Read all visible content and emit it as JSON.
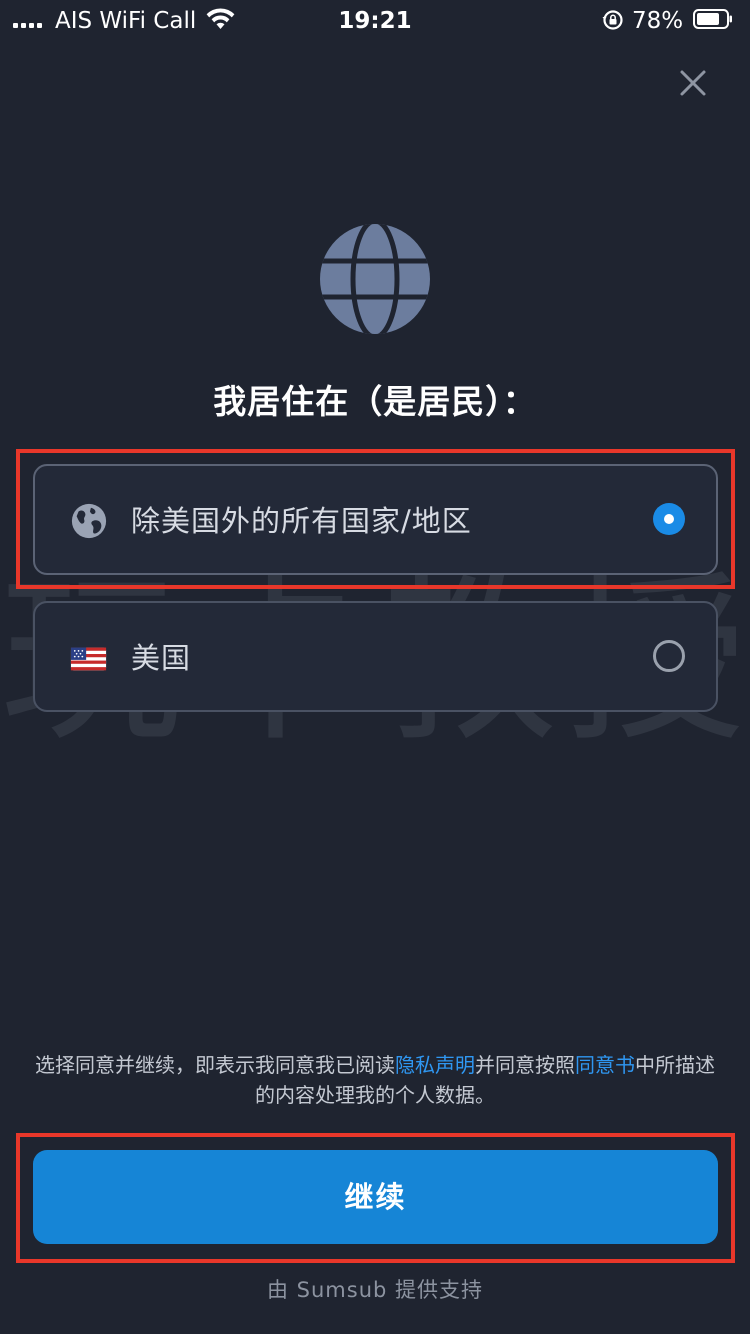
{
  "status_bar": {
    "carrier": "AIS WiFi Call",
    "time": "19:21",
    "battery_percent": "78%"
  },
  "icons": {
    "close": "close-icon",
    "hero": "globe-icon",
    "world_option": "globe-icon",
    "us_option": "us-flag-icon"
  },
  "heading": "我居住在（是居民）：",
  "options": [
    {
      "label": "除美国外的所有国家/地区",
      "selected": true
    },
    {
      "label": "美国",
      "selected": false
    }
  ],
  "watermark": "玩卡教授",
  "consent": {
    "text_before": "选择同意并继续，即表示我同意我已阅读",
    "privacy_link": "隐私声明",
    "text_middle": "并同意按照",
    "agreement_link": "同意书",
    "text_after": "中所描述的内容处理我的个人数据。"
  },
  "continue_label": "继续",
  "powered_by": "由 Sumsub 提供支持",
  "colors": {
    "background": "#1f2430",
    "accent": "#1685d6",
    "link": "#2f97f2",
    "highlight": "#e8372a"
  }
}
